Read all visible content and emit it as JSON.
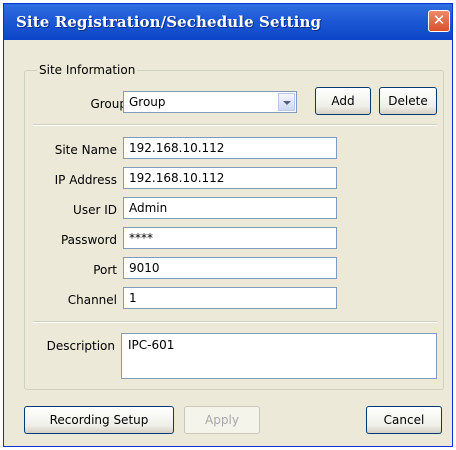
{
  "window": {
    "title": "Site Registration/Sechedule Setting",
    "close_symbol": "✕"
  },
  "site_info": {
    "legend": "Site Information",
    "group_label": "Group",
    "group_value": "Group",
    "add_label": "Add",
    "delete_label": "Delete",
    "fields": {
      "site_name": {
        "label": "Site Name",
        "value": "192.168.10.112"
      },
      "ip_address": {
        "label": "IP Address",
        "value": "192.168.10.112"
      },
      "user_id": {
        "label": "User ID",
        "value": "Admin"
      },
      "password": {
        "label": "Password",
        "value": "****"
      },
      "port": {
        "label": "Port",
        "value": "9010"
      },
      "channel": {
        "label": "Channel",
        "value": "1"
      }
    },
    "description": {
      "label": "Description",
      "value": "IPC-601"
    }
  },
  "footer": {
    "recording_setup_label": "Recording Setup",
    "apply_label": "Apply",
    "cancel_label": "Cancel"
  }
}
